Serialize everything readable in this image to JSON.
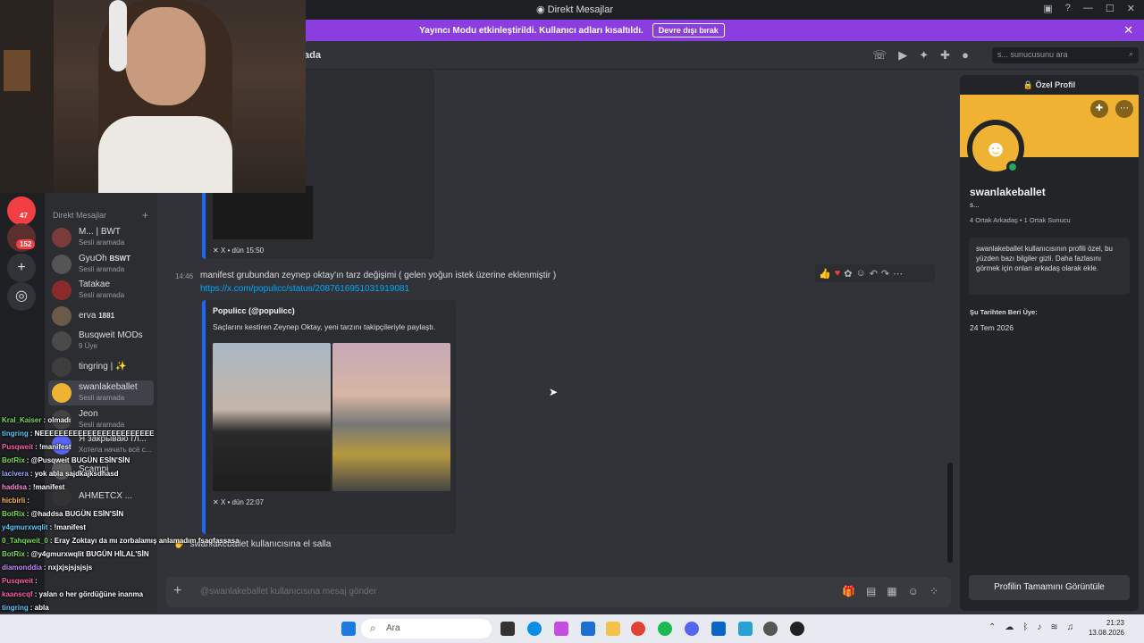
{
  "window": {
    "title": "Direkt Mesajlar"
  },
  "banner": {
    "text": "Yayıncı Modu etkinleştirildi. Kullanıcı adları kısaltıldı.",
    "button": "Devre dışı bırak"
  },
  "topbar": {
    "channel": "ada",
    "search_placeholder": "s... sunucusunu ara"
  },
  "guilds": {
    "badges": [
      "47",
      "152"
    ]
  },
  "dms": {
    "header": "Direkt Mesajlar",
    "items": [
      {
        "name": "M... | BWT",
        "sub": "Sesli aramada"
      },
      {
        "name": "GyuOh",
        "badge": "BSWT",
        "sub": "Sesli aramada"
      },
      {
        "name": "Tatakae",
        "sub": "Sesli aramada"
      },
      {
        "name": "erva",
        "badge": "1881",
        "sub": ""
      },
      {
        "name": "Busqweit MODs",
        "sub": "9 Üye"
      },
      {
        "name": "tingring | ✨",
        "sub": ""
      },
      {
        "name": "swanlakeballet",
        "sub": "Sesli aramada"
      },
      {
        "name": "Jeon",
        "sub": "Sesli aramada"
      },
      {
        "name": "Я закрываю гл...",
        "sub": "Хотела начать всё с..."
      },
      {
        "name": "Scampi",
        "sub": ""
      },
      {
        "name": "AHMETCX ...",
        "sub": ""
      }
    ]
  },
  "chat": {
    "top_embed_footer": "X • dün 15:50",
    "message": {
      "time": "14:46",
      "text": "manifest grubundan zeynep oktay'ın tarz değişimi ( gelen yoğun istek üzerine eklenmiştir )",
      "link": "https://x.com/populicc/status/2087616951031919081"
    },
    "embed": {
      "author": "Populicc (@populicc)",
      "description": "Saçlarını kestiren Zeynep Oktay, yeni tarzını takipçileriyle paylaştı.",
      "footer": "X • dün 22:07"
    },
    "wave_text": "swanlakeballet kullanıcısına el salla",
    "composer_placeholder": "@swanlakeballet kullanıcısına mesaj gönder"
  },
  "profile": {
    "header": "Özel Profil",
    "name": "swanlakeballet",
    "username": "s...",
    "mutual": "4 Ortak Arkadaş • 1 Ortak Sunucu",
    "note": "swanlakeballet kullanıcısının profili özel, bu yüzden bazı bilgiler gizli. Daha fazlasını görmek için onları arkadaş olarak ekle.",
    "since_label": "Şu Tarihten Beri Üye:",
    "since_date": "24 Tem 2026",
    "full_button": "Profilin Tamamını Görüntüle"
  },
  "overlay_chat": [
    {
      "user": "Kral_Kaiser",
      "msg": "olmadı",
      "color": "#7bd957"
    },
    {
      "user": "tingring",
      "msg": "NEEEEEEEEEEEEEEEEEEEEEEEE",
      "color": "#5ec8ff"
    },
    {
      "user": "Pusqweit",
      "msg": "!manifest",
      "color": "#ff5db1"
    },
    {
      "user": "BotRix",
      "msg": "@Pusqweit BUGÜN ESİN'SİN",
      "color": "#7bd957"
    },
    {
      "user": "lacivera",
      "msg": "yok abla sajdkajksdhasd",
      "color": "#9aa4ff"
    },
    {
      "user": "haddsa",
      "msg": "!manifest",
      "color": "#ff8ad8"
    },
    {
      "user": "hicbirli",
      "msg": "",
      "color": "#ffb84d"
    },
    {
      "user": "BotRix",
      "msg": "@haddsa BUGÜN ESİN'SİN",
      "color": "#7bd957"
    },
    {
      "user": "y4gmurxwqlit",
      "msg": "!manifest",
      "color": "#5ec8ff"
    },
    {
      "user": "0_Tahqweit_0",
      "msg": "Eray Zoktayı da mı zorbalamış anlamadım fsagfassasa",
      "color": "#7bd957"
    },
    {
      "user": "BotRix",
      "msg": "@y4gmurxwqlit BUGÜN HİLAL'SİN",
      "color": "#7bd957"
    },
    {
      "user": "diamonddia",
      "msg": "nxjxjsjsjsjsjs",
      "color": "#c58cff"
    },
    {
      "user": "Pusqweit",
      "msg": "",
      "color": "#ff5db1"
    },
    {
      "user": "kaanscqf",
      "msg": "yalan o her gördüğüne inanma",
      "color": "#ff5db1"
    },
    {
      "user": "tingring",
      "msg": "abla",
      "color": "#5ec8ff"
    }
  ],
  "taskbar": {
    "search": "Ara",
    "time": "21:23",
    "date": "13.08.2026"
  }
}
